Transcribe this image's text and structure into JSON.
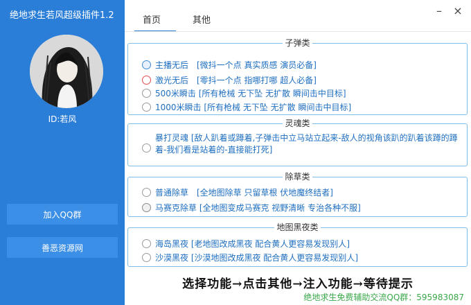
{
  "app": {
    "title": "绝地求生若风超级插件1.2"
  },
  "sidebar": {
    "user_id": "ID:若风",
    "buttons": [
      {
        "label": "加入QQ群"
      },
      {
        "label": "善恶资源网"
      }
    ]
  },
  "tabs": [
    {
      "label": "首页",
      "active": true
    },
    {
      "label": "其他",
      "active": false
    }
  ],
  "window_controls": {
    "minimize": "–",
    "close": "×"
  },
  "groups": {
    "bullet": {
      "title": "子弹类",
      "options": [
        {
          "label": "主播无后　[微抖一个点 真实质感 演员必备]"
        },
        {
          "label": "激光无后　[零抖一个点 指哪打哪 超人必备]"
        },
        {
          "label": "500米瞬击  [所有枪械 无下坠 无扩散 瞬间击中目标]"
        },
        {
          "label": "1000米瞬击  [所有枪械 无下坠 无扩散 瞬间击中目标]"
        }
      ]
    },
    "soul": {
      "title": "灵魂类",
      "options": [
        {
          "label": "暴打灵魂 [敌人趴着或蹲着,子弹击中立马站立起来-敌人的视角该趴的趴着该蹲的蹲着-我们看是站着的-直接能打死]"
        }
      ]
    },
    "grass": {
      "title": "除草类",
      "options": [
        {
          "label": "普通除草　[全地图除草 只留草根 伏地魔终结者]"
        },
        {
          "label": "马赛克除草 [全地图变成马赛克 视野清晰 专治各种不服]"
        }
      ]
    },
    "night": {
      "title": "地图黑夜类",
      "options": [
        {
          "label": "海岛黑夜 [老地图改成黑夜 配合黄人更容易发现别人]"
        },
        {
          "label": "沙漠黑夜 [沙漠地图改成黑夜 配合黄人更容易发现别人]"
        }
      ]
    }
  },
  "instruction": "选择功能→点击其他→注入功能→等待提示",
  "footer": "绝地求生免费辅助交流QQ群：595983087",
  "colors": {
    "accent": "#2b7ed8",
    "option_text": "#1f6fc0",
    "group_border": "#7fbde9",
    "footer_text": "#3aa84a"
  }
}
